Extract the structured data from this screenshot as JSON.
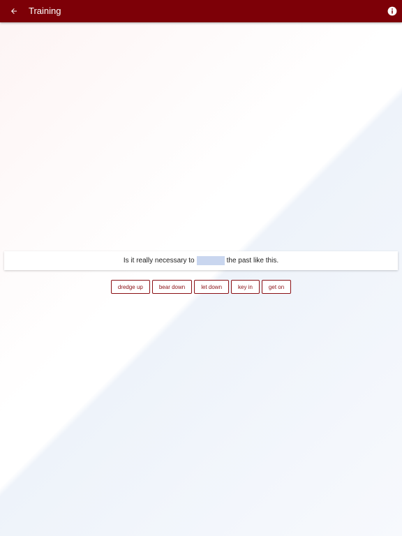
{
  "appbar": {
    "title": "Training",
    "back_icon": "arrow-left-icon",
    "info_icon": "info-circle-icon",
    "color": "#7d0007"
  },
  "exercise": {
    "sentence_before": "Is it really necessary to",
    "sentence_after": "the past like this.",
    "blank_color": "#c9d6ef"
  },
  "options": [
    "dredge up",
    "bear down",
    "let down",
    "key in",
    "get on"
  ],
  "colors": {
    "option_border": "#8a0f14",
    "background_top": "#fdf4f4",
    "background_bottom": "#eef3fa"
  }
}
